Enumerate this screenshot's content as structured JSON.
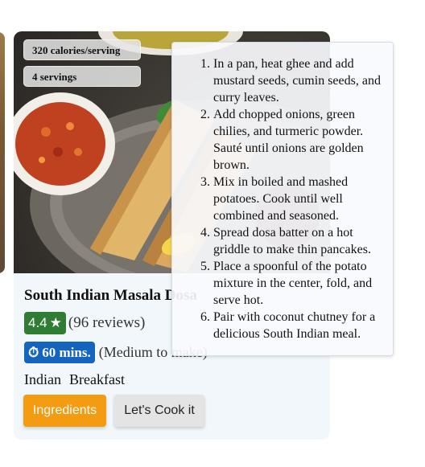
{
  "recipe": {
    "title": "South Indian Masala Dosa",
    "calories": "320 calories/serving",
    "servings": "4 servings",
    "rating": "4.4",
    "rating_icon": "star-icon",
    "reviews": "(96 reviews)",
    "time": "60 mins.",
    "time_icon": "stopwatch-icon",
    "difficulty": "(Medium to make)",
    "tags": [
      "Indian",
      "Breakfast"
    ]
  },
  "actions": {
    "ingredients_label": "Ingredients",
    "cook_label": "Let's Cook it"
  },
  "steps": [
    "In a pan, heat ghee and add mustard seeds, cumin seeds, and curry leaves.",
    "Add chopped onions, green chilies, and turmeric powder. Sauté until onions are golden brown.",
    "Mix in boiled and mashed potatoes. Cook until well combined and seasoned.",
    "Spread dosa batter on a hot griddle to make thin pancakes.",
    "Place a spoonful of the potato mixture in the center, fold, and serve hot.",
    "Pair with coconut chutney for a delicious South Indian meal."
  ],
  "colors": {
    "rating_badge": "#2e7d32",
    "time_badge": "#1565c0",
    "ingredients_button": "#f39c12",
    "card_background": "#f1f7fb"
  }
}
